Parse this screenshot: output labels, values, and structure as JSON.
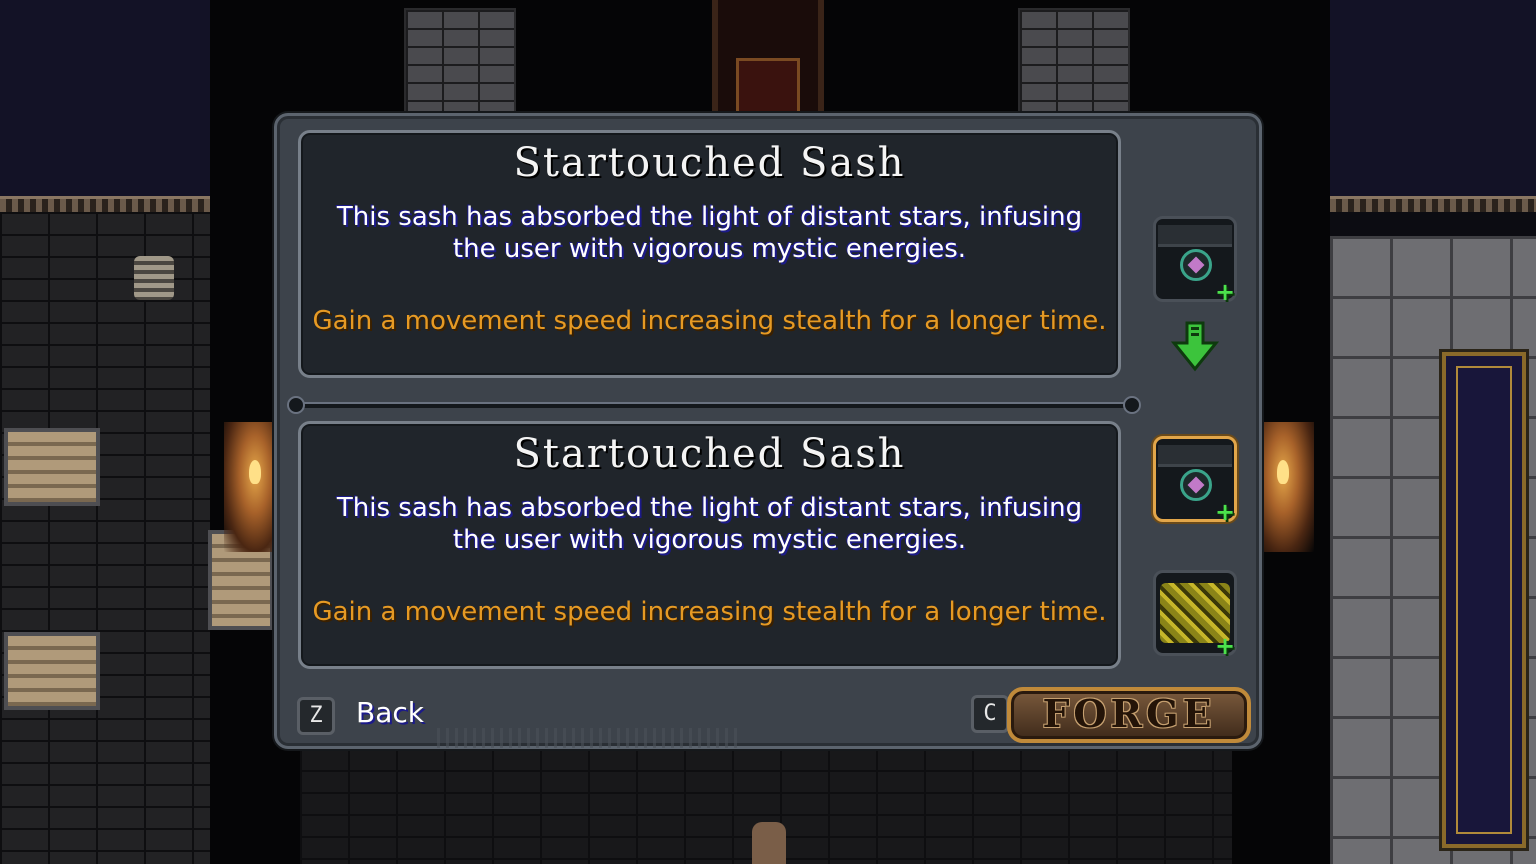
{
  "upper_item": {
    "name": "Startouched Sash",
    "description_line1": "This sash has absorbed the light of distant stars, infusing",
    "description_line2": "the user with vigorous mystic energies.",
    "effect": "Gain a movement speed increasing stealth for a longer time."
  },
  "lower_item": {
    "name": "Startouched Sash",
    "description_line1": "This sash has absorbed the light of distant stars, infusing",
    "description_line2": "the user with vigorous mystic energies.",
    "effect": "Gain a movement speed increasing stealth for a longer time."
  },
  "slots": {
    "result_icon": "startouched-sash-icon",
    "selected_icon": "startouched-sash-icon",
    "material_icon": "gold-sash-icon",
    "upgrade_marker": "+",
    "arrow_icon": "green-down-arrow-icon"
  },
  "controls": {
    "back_key": "Z",
    "back_label": "Back",
    "forge_key": "C",
    "forge_label": "FORGE"
  },
  "colors": {
    "effect_text": "#e69a24",
    "description_shadow": "#1c1a8a",
    "selection_border": "#e2a64a",
    "plus_green": "#4ce24c"
  }
}
